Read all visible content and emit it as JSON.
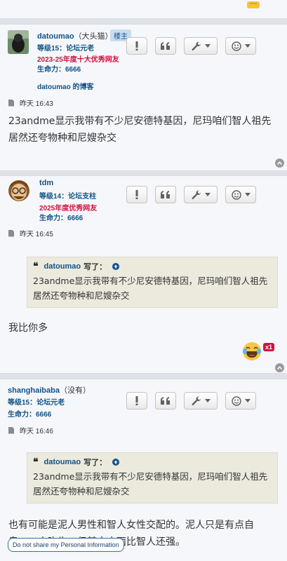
{
  "posts": [
    {
      "username": "datoumao",
      "nickname": "（大头猫）",
      "badge": "楼主",
      "rank": "等级15：论坛元老",
      "award": "2023-25年度十大优秀网友",
      "life": "生命力：6666",
      "blog": "datoumao 的博客",
      "time": "昨天 16:43",
      "content": "23andme显示我带有不少尼安德特基因，尼玛咱们智人祖先居然还夸物种和尼嫂杂交"
    },
    {
      "username": "tdm",
      "rank": "等级14：论坛支柱",
      "award": "2025年度优秀网友",
      "life": "生命力：6666",
      "time": "昨天 16:45",
      "quote_author": "datoumao",
      "quote_wrote": "写了：",
      "quote_text": "23andme显示我带有不少尼安德特基因，尼玛咱们智人祖先居然还夸物种和尼嫂杂交",
      "content": "我比你多",
      "reaction_count": "x1"
    },
    {
      "username": "shanghaibaba",
      "nickname": "（没有）",
      "rank": "等级15：论坛元老",
      "life": "生命力：6666",
      "time": "昨天 16:46",
      "quote_author": "datoumao",
      "quote_wrote": "写了：",
      "quote_text": "23andme显示我带有不少尼安德特基因，尼玛咱们智人祖先居然还夸物种和尼嫂杂交",
      "content": "也有可能是泥人男性和智人女性交配的。泥人只是有点自卑……人吹牛，但其它方面比智人还强。"
    }
  ],
  "privacy_button": "Do not share my Personal Information",
  "icons": [
    "report-icon",
    "quote-icon",
    "wrench-icon",
    "smiley-icon",
    "back-to-top-icon",
    "post-icon",
    "laughing-emoji-icon",
    "thumbs-up-emoji-icon"
  ],
  "colors": {
    "link": "#105289",
    "award": "#d31141",
    "post_bg": "#f5f7fa",
    "quote_bg": "#ebeadd"
  }
}
